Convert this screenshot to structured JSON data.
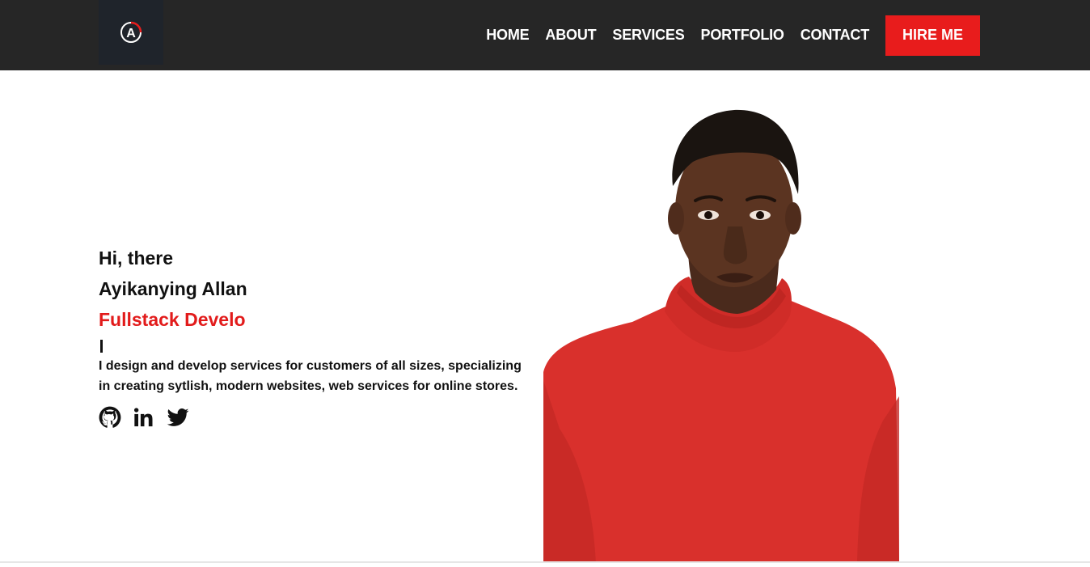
{
  "nav": {
    "logo_letter": "A",
    "links": [
      "HOME",
      "ABOUT",
      "SERVICES",
      "PORTFOLIO",
      "CONTACT"
    ],
    "cta_label": "HIRE ME"
  },
  "hero": {
    "greeting": "Hi, there",
    "name": "Ayikanying Allan",
    "role_typed": "Fullstack Develo",
    "bio": "I design and develop services for customers of all sizes, specializing in creating sytlish, modern websites, web services for online stores.",
    "social_icons": [
      "github-icon",
      "linkedin-icon",
      "twitter-icon"
    ]
  },
  "colors": {
    "navbar_bg": "#262626",
    "accent": "#e81c1c",
    "text": "#111111",
    "shirt": "#d9302c"
  }
}
